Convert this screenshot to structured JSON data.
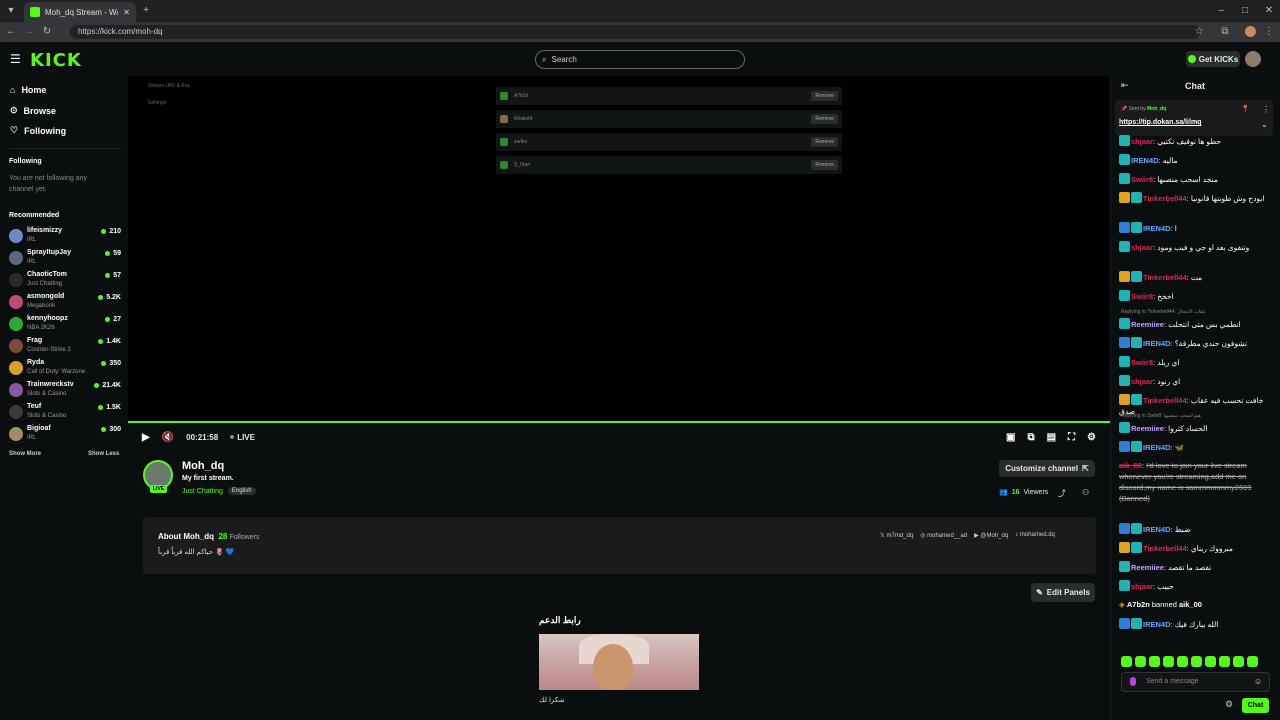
{
  "browser": {
    "tab_title": "Moh_dq Stream - Watch Live o",
    "url": "https://kick.com/moh-dq"
  },
  "header": {
    "logo": "KICK",
    "search_placeholder": "Search",
    "get_kicks": "Get KICKs"
  },
  "sidebar": {
    "nav": [
      "Home",
      "Browse",
      "Following"
    ],
    "following_title": "Following",
    "following_empty": "You are not following any channel yet.",
    "recommended_title": "Recommended",
    "recommended": [
      {
        "name": "lifeismizzy",
        "category": "IRL",
        "viewers": "210",
        "color": "#6b8cc9"
      },
      {
        "name": "SprayItupJay",
        "category": "IRL",
        "viewers": "59",
        "color": "#5a6a7a"
      },
      {
        "name": "ChaoticTom",
        "category": "Just Chatting",
        "viewers": "57",
        "color": "#2a2a2a"
      },
      {
        "name": "asmongold",
        "category": "Megabonk",
        "viewers": "5.2K",
        "color": "#c24a7a"
      },
      {
        "name": "kennyhoopz",
        "category": "NBA 2K26",
        "viewers": "27",
        "color": "#2fa83a"
      },
      {
        "name": "Frag",
        "category": "Counter-Strike 2",
        "viewers": "1.4K",
        "color": "#7a4a3a"
      },
      {
        "name": "Ryda",
        "category": "Call of Duty: Warzone",
        "viewers": "350",
        "color": "#d4a22a"
      },
      {
        "name": "Trainwreckstv",
        "category": "Slots & Casino",
        "viewers": "21.4K",
        "color": "#8a5aa0"
      },
      {
        "name": "Teuf",
        "category": "Slots & Casino",
        "viewers": "1.5K",
        "color": "#3a3a3a"
      },
      {
        "name": "Bigioaf",
        "category": "IRL",
        "viewers": "300",
        "color": "#a08a6a"
      }
    ],
    "show_more": "Show More",
    "show_less": "Show Less"
  },
  "video_bg": {
    "menu": [
      "Stream URL & Key",
      "Settings"
    ],
    "rows": [
      {
        "name": "A7b2n",
        "action": "Remove"
      },
      {
        "name": "Khaled4",
        "action": "Remove"
      },
      {
        "name": "zuriks",
        "action": "Remove"
      },
      {
        "name": "S_0ran",
        "action": "Remove"
      }
    ]
  },
  "player": {
    "time": "00:21:58",
    "live": "LIVE"
  },
  "channel": {
    "name": "Moh_dq",
    "title": "My first stream.",
    "category": "Just Chatting",
    "language": "English",
    "live_badge": "LIVE",
    "customize": "Customize channel",
    "viewers": "16",
    "viewers_label": "Viewers"
  },
  "about": {
    "title": "About Moh_dq",
    "followers": "28",
    "followers_label": "Followers",
    "description": "حياكم الله قرباً قرباً 🌷 💙",
    "socials": [
      "m7md_dq",
      "mohamed__ad",
      "@Moh_dq",
      "mohamed.dq"
    ]
  },
  "panels": {
    "edit": "Edit Panels",
    "title": "رابط الدعم",
    "caption": "شكرا لك"
  },
  "chat": {
    "title": "Chat",
    "pinned_by_label": "Sent by",
    "pinned_by": "Moh_dq",
    "pinned_link": "https://tip.dokan.sa/lilmq",
    "messages": [
      {
        "user": "shjaar",
        "color": "#e0245e",
        "text": "حطو ها توقيف تكتيي",
        "badges": [
          "cyan"
        ]
      },
      {
        "user": "IREN4D",
        "color": "#5fa8ff",
        "text": "ماليه",
        "badges": [
          "cyan"
        ]
      },
      {
        "user": "Swiir8",
        "color": "#e0245e",
        "text": "منجد اسحب منصبها",
        "badges": [
          "cyan"
        ]
      },
      {
        "user": "Tinkerbell44",
        "color": "#e0245e",
        "text": "ابودح وش طوبتها قانونيا",
        "badges": [
          "gold",
          "cyan"
        ]
      },
      {
        "user": "IREN4D",
        "color": "#5fa8ff",
        "text": "ا",
        "badges": [
          "blue",
          "cyan"
        ]
      },
      {
        "user": "shjaar",
        "color": "#e0245e",
        "text": "وتنقوى بعد او جي و فيب ومود",
        "badges": [
          "cyan"
        ]
      },
      {
        "user": "Tinkerbell44",
        "color": "#e0245e",
        "text": "مت",
        "badges": [
          "gold",
          "cyan"
        ]
      },
      {
        "user": "Swiir8",
        "color": "#e0245e",
        "text": "اخخخ",
        "badges": [
          "cyan"
        ]
      },
      {
        "user": "Reemiiee",
        "color": "#c9a0ff",
        "text": "انطمي بس متى انتحلت",
        "badges": [
          "cyan"
        ],
        "reply": "Replying to Tinkerbell44: عقاب الانتحال"
      },
      {
        "user": "IREN4D",
        "color": "#5fa8ff",
        "text": "تشوفون حندي مطرقة؟",
        "badges": [
          "blue",
          "cyan"
        ]
      },
      {
        "user": "Swiir8",
        "color": "#e0245e",
        "text": "اي ريلد",
        "badges": [
          "cyan"
        ]
      },
      {
        "user": "shjaar",
        "color": "#e0245e",
        "text": "اي رنود",
        "badges": [
          "cyan"
        ]
      },
      {
        "user": "Tinkerbell44",
        "color": "#e0245e",
        "text": "خافت تحسب فيه عقاب صدق",
        "badges": [
          "gold",
          "cyan"
        ]
      },
      {
        "user": "Reemiiee",
        "color": "#c9a0ff",
        "text": "الحساد كثروا",
        "badges": [
          "cyan"
        ],
        "reply": "Replying to Swiir8: هنو اسحب منصبها"
      },
      {
        "user": "IREN4D",
        "color": "#5fa8ff",
        "text": "🦋",
        "badges": [
          "blue",
          "cyan"
        ]
      },
      {
        "user": "aik_00",
        "color": "#e0245e",
        "text": "I'd love to join your live stream whenever you're streaming,add me on discord,my name is sammmmmmy2609 (Banned)",
        "badges": [],
        "banned": true
      },
      {
        "user": "IREN4D",
        "color": "#5fa8ff",
        "text": "ضبط",
        "badges": [
          "blue",
          "cyan"
        ]
      },
      {
        "user": "Tinkerbell44",
        "color": "#e0245e",
        "text": "مبرووك ريناي",
        "badges": [
          "gold",
          "cyan"
        ]
      },
      {
        "user": "Reemiiee",
        "color": "#c9a0ff",
        "text": "تقصد ما تقصد",
        "badges": [
          "cyan"
        ]
      },
      {
        "user": "shjaar",
        "color": "#e0245e",
        "text": "حبيب",
        "badges": [
          "cyan"
        ]
      },
      {
        "user": "A7b2n",
        "color": "#ffffff",
        "text": "aik_00",
        "badges": [],
        "system": true,
        "mid": "banned"
      },
      {
        "user": "IREN4D",
        "color": "#5fa8ff",
        "text": "الله يبارك فيك",
        "badges": [
          "blue",
          "cyan"
        ]
      }
    ],
    "input_placeholder": "Send a message",
    "send": "Chat"
  }
}
